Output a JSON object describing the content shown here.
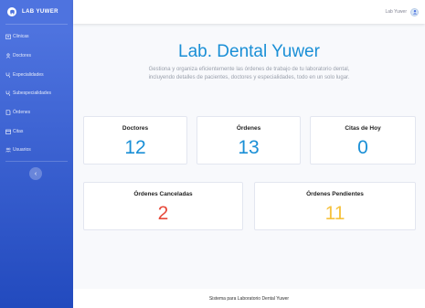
{
  "brand": {
    "name": "LAB YUWER"
  },
  "sidebar": {
    "items": [
      {
        "label": "Clinicas",
        "icon": "hospital-icon"
      },
      {
        "label": "Doctores",
        "icon": "user-icon"
      },
      {
        "label": "Especialidades",
        "icon": "stethoscope-icon"
      },
      {
        "label": "Subespecialidades",
        "icon": "stethoscope-icon"
      },
      {
        "label": "Órdenes",
        "icon": "file-icon"
      },
      {
        "label": "Citas",
        "icon": "calendar-icon"
      },
      {
        "label": "Usuarios",
        "icon": "users-icon"
      }
    ],
    "toggle_label": "‹"
  },
  "topbar": {
    "user_name": "Lab Yuwer"
  },
  "main": {
    "title": "Lab. Dental Yuwer",
    "description": "Gestiona y organiza eficientemente las órdenes de trabajo de tu laboratorio dental, incluyendo detalles de pacientes, doctores y especialidades, todo en un solo lugar."
  },
  "stats": {
    "doctores": {
      "label": "Doctores",
      "value": "12",
      "color": "#1a8fd6"
    },
    "ordenes": {
      "label": "Órdenes",
      "value": "13",
      "color": "#1a8fd6"
    },
    "citas": {
      "label": "Citas de Hoy",
      "value": "0",
      "color": "#1a8fd6"
    },
    "canceladas": {
      "label": "Órdenes Canceladas",
      "value": "2",
      "color": "#e74a3b"
    },
    "pendientes": {
      "label": "Órdenes Pendientes",
      "value": "11",
      "color": "#f6c23e"
    }
  },
  "footer": {
    "text": "Sistema para Laboratorio Dental Yuwer"
  }
}
